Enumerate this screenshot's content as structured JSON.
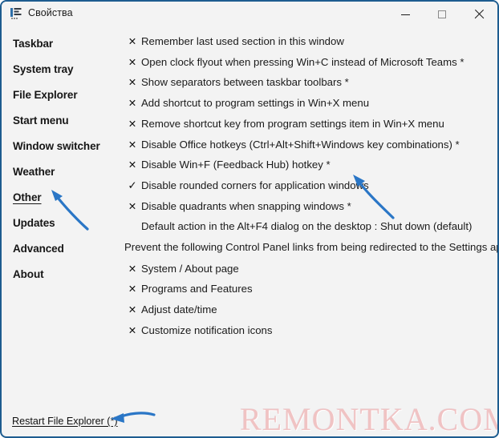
{
  "window": {
    "title": "Свойства",
    "icon": "properties-app-icon",
    "controls": {
      "minimize": "—",
      "maximize": "▢",
      "close": "✕"
    }
  },
  "sidebar": {
    "items": [
      {
        "label": "Taskbar",
        "active": false
      },
      {
        "label": "System tray",
        "active": false
      },
      {
        "label": "File Explorer",
        "active": false
      },
      {
        "label": "Start menu",
        "active": false
      },
      {
        "label": "Window switcher",
        "active": false
      },
      {
        "label": "Weather",
        "active": false
      },
      {
        "label": "Other",
        "active": true
      },
      {
        "label": "Updates",
        "active": false
      },
      {
        "label": "Advanced",
        "active": false
      },
      {
        "label": "About",
        "active": false
      }
    ]
  },
  "main": {
    "options": [
      {
        "mark": "✕",
        "state": "off",
        "label": "Remember last used section in this window"
      },
      {
        "mark": "✕",
        "state": "off",
        "label": "Open clock flyout when pressing Win+C instead of Microsoft Teams *"
      },
      {
        "mark": "✕",
        "state": "off",
        "label": "Show separators between taskbar toolbars *"
      },
      {
        "mark": "✕",
        "state": "off",
        "label": "Add shortcut to program settings in Win+X menu"
      },
      {
        "mark": "✕",
        "state": "off",
        "label": "Remove shortcut key from program settings item in Win+X menu"
      },
      {
        "mark": "✕",
        "state": "off",
        "label": "Disable Office hotkeys (Ctrl+Alt+Shift+Windows key combinations) *"
      },
      {
        "mark": "✕",
        "state": "off",
        "label": "Disable Win+F (Feedback Hub) hotkey *"
      },
      {
        "mark": "✓",
        "state": "on",
        "label": "Disable rounded corners for application windows"
      },
      {
        "mark": "✕",
        "state": "off",
        "label": "Disable quadrants when snapping windows *"
      }
    ],
    "default_action_line": "Default action in the Alt+F4 dialog on the desktop : Shut down (default)",
    "section_note": "Prevent the following Control Panel links from being redirected to the Settings app:",
    "control_panel_options": [
      {
        "mark": "✕",
        "state": "off",
        "label": "System / About page"
      },
      {
        "mark": "✕",
        "state": "off",
        "label": "Programs and Features"
      },
      {
        "mark": "✕",
        "state": "off",
        "label": "Adjust date/time"
      },
      {
        "mark": "✕",
        "state": "off",
        "label": "Customize notification icons"
      }
    ]
  },
  "footer": {
    "restart_link": "Restart File Explorer (*)"
  },
  "watermark": {
    "text": "REMONTKA.COM"
  },
  "colors": {
    "window_border": "#1d5c8f",
    "background": "#f3f3f3",
    "text": "#1a1a1a",
    "annotation_arrow": "#2a76c6",
    "watermark": "#f0bfc0"
  }
}
